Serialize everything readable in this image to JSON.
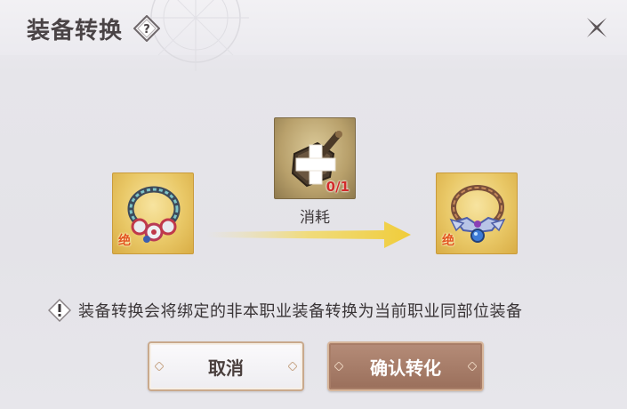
{
  "dialog": {
    "title": "装备转换",
    "help_icon": "question-mark-diamond-icon",
    "close_icon": "close-x-icon"
  },
  "conversion": {
    "source_item": {
      "icon": "necklace-icon",
      "grade_label": "绝"
    },
    "material_item": {
      "icon": "hammer-material-icon",
      "overlay_icon": "plus-icon",
      "count": "0/1"
    },
    "consume_label": "消耗",
    "arrow_icon": "right-arrow-icon",
    "result_item": {
      "icon": "necklace-icon",
      "grade_label": "绝"
    }
  },
  "notice": {
    "icon": "warning-diamond-icon",
    "text": "装备转换会将绑定的非本职业装备转换为当前职业同部位装备"
  },
  "buttons": {
    "cancel_label": "取消",
    "confirm_label": "确认转化"
  },
  "colors": {
    "background": "#e6e5ea",
    "confirm_button": "#a67b66",
    "cancel_border": "#c9a98c",
    "count_text": "#d22b2b",
    "grade_text": "#e2541f",
    "arrow": "#f2d24a"
  }
}
